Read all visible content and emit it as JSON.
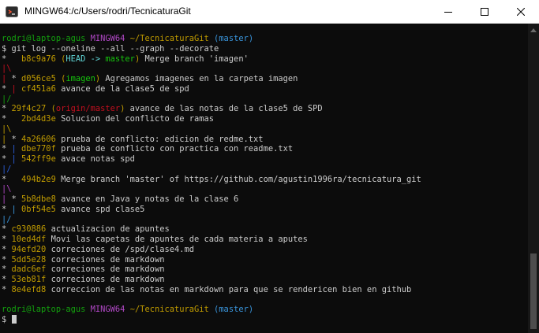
{
  "window": {
    "title": "MINGW64:/c/Users/rodri/TecnicaturaGit"
  },
  "prompt": {
    "user_host": "rodri@laptop-agus",
    "shell": "MINGW64",
    "path": "~/TecnicaturaGit",
    "branch": "(master)"
  },
  "command": "$ git log --oneline --all --graph --decorate",
  "log": {
    "l1": {
      "graph": "*   ",
      "hash": "b8c9a76",
      "ref_open": " (",
      "head": "HEAD -> ",
      "branch": "master",
      "ref_close": ")",
      "msg": " Merge branch 'imagen'"
    },
    "l2": {
      "graph": "|\\"
    },
    "l3": {
      "g1": "| ",
      "g2": "* ",
      "hash": "d056ce5",
      "ref_open": " (",
      "branch": "imagen",
      "ref_close": ")",
      "msg": " Agregamos imagenes en la carpeta imagen"
    },
    "l4": {
      "g1": "* ",
      "g2": "| ",
      "hash": "cf451a6",
      "msg": " avance de la clase5 de spd"
    },
    "l5": {
      "graph": "|/"
    },
    "l6": {
      "graph": "* ",
      "hash": "29f4c27",
      "ref_open": " (",
      "branch": "origin/master",
      "ref_close": ")",
      "msg": " avance de las notas de la clase5 de SPD"
    },
    "l7": {
      "graph": "*   ",
      "hash": "2bd4d3e",
      "msg": " Solucion del conflicto de ramas"
    },
    "l8": {
      "graph": "|\\"
    },
    "l9": {
      "g1": "| ",
      "g2": "* ",
      "hash": "4a26606",
      "msg": " prueba de conflicto: edicion de redme.txt"
    },
    "l10": {
      "g1": "* ",
      "g2": "| ",
      "hash": "dbe770f",
      "msg": " prueba de conflicto con practica con readme.txt"
    },
    "l11": {
      "g1": "* ",
      "g2": "| ",
      "hash": "542ff9e",
      "msg": " avace notas spd"
    },
    "l12": {
      "graph": "|/"
    },
    "l13": {
      "graph": "*   ",
      "hash": "494b2e9",
      "msg": " Merge branch 'master' of https://github.com/agustin1996ra/tecnicatura_git"
    },
    "l14": {
      "graph": "|\\"
    },
    "l15": {
      "g1": "| ",
      "g2": "* ",
      "hash": "5b8dbe8",
      "msg": " avance en Java y notas de la clase 6"
    },
    "l16": {
      "g1": "* ",
      "g2": "| ",
      "hash": "0bf54e5",
      "msg": " avance spd clase5"
    },
    "l17": {
      "graph": "|/"
    },
    "l18": {
      "graph": "* ",
      "hash": "c930886",
      "msg": " actualizacion de apuntes"
    },
    "l19": {
      "graph": "* ",
      "hash": "10ed4df",
      "msg": " Movi las capetas de apuntes de cada materia a aputes"
    },
    "l20": {
      "graph": "* ",
      "hash": "94efd20",
      "msg": " correciones de /spd/clase4.md"
    },
    "l21": {
      "graph": "* ",
      "hash": "5dd5e28",
      "msg": " correciones de markdown"
    },
    "l22": {
      "graph": "* ",
      "hash": "dadc6ef",
      "msg": " correciones de markdown"
    },
    "l23": {
      "graph": "* ",
      "hash": "53eb81f",
      "msg": " correciones de markdown"
    },
    "l24": {
      "graph": "* ",
      "hash": "8e4efd8",
      "msg": " correccion de las notas en markdown para que se rendericen bien en github"
    }
  },
  "prompt_symbol": "$ ",
  "icons": {
    "app": "git-bash-icon",
    "minimize": "minimize-icon",
    "maximize": "maximize-icon",
    "close": "close-icon",
    "scroll_up": "scroll-up-icon"
  },
  "colors": {
    "user_host": "#13a10e",
    "shell": "#b148c6",
    "path": "#c19c00",
    "branch": "#3a96dd",
    "hash": "#c19c00",
    "head": "#61d6d6",
    "local_branch": "#16c60c",
    "remote_branch": "#c50f1f",
    "graph_red": "#c50f1f",
    "graph_green": "#13a10e",
    "graph_blue": "#2b5fdc"
  }
}
